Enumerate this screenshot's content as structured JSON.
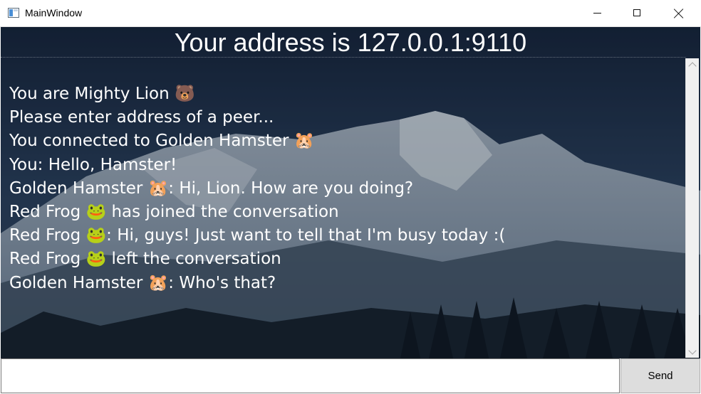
{
  "window": {
    "title": "MainWindow",
    "icon": "app-window-icon",
    "controls": [
      "minimize-icon",
      "maximize-icon",
      "close-icon"
    ]
  },
  "header": {
    "address": "Your address is 127.0.0.1:9110"
  },
  "chat": {
    "lines": [
      "You are Mighty Lion 🐻",
      "Please enter address of a peer...",
      "You connected to Golden Hamster 🐹",
      "You: Hello, Hamster!",
      "Golden Hamster 🐹: Hi, Lion. How are you doing?",
      "Red Frog 🐸 has joined the conversation",
      "Red Frog 🐸: Hi, guys! Just want to tell that I'm busy today :(",
      "Red Frog 🐸 left the conversation",
      "Golden Hamster 🐹: Who's that?"
    ]
  },
  "input": {
    "value": "",
    "send_label": "Send"
  },
  "colors": {
    "text": "#ffffff",
    "button_bg": "#dddddd"
  }
}
